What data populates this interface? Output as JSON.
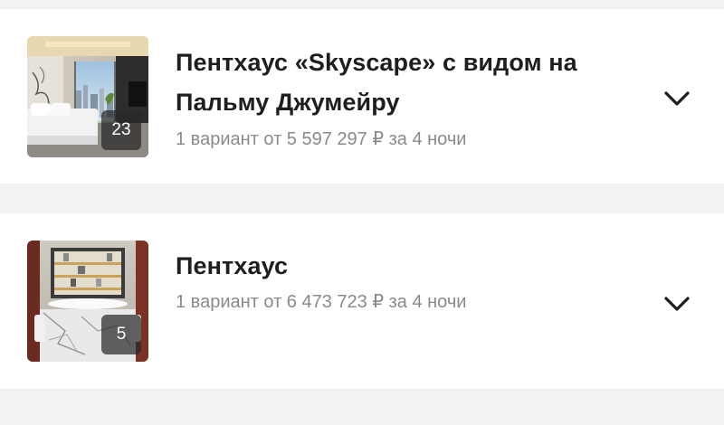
{
  "rooms": [
    {
      "title": "Пентхаус «Skyscape» с видом на Пальму Джумейру",
      "photo_count": "23",
      "summary": "1 вариант от 5 597 297 ₽ за 4 ночи",
      "expand_icon": "chevron-down-icon"
    },
    {
      "title": "Пентхаус",
      "photo_count": "5",
      "summary": "1 вариант от 6 473 723 ₽ за 4 ночи",
      "expand_icon": "chevron-down-icon"
    }
  ],
  "colors": {
    "background": "#f2f2f4",
    "card": "#ffffff",
    "title": "#1e1e1e",
    "subtitle": "#8a8a8e",
    "badge": "#282828"
  }
}
